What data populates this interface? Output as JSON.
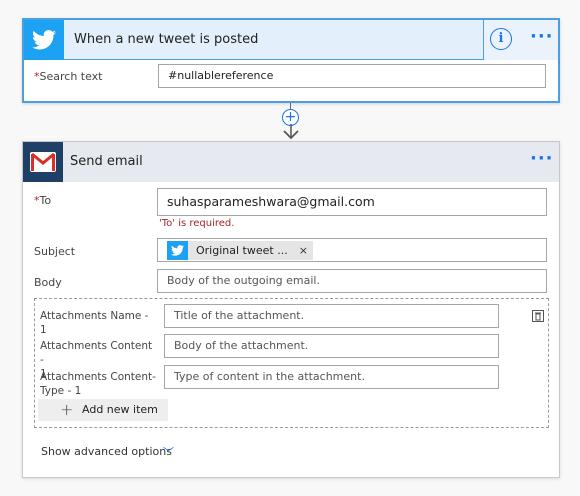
{
  "trigger": {
    "title": "When a new tweet is posted",
    "search_label": "Search text",
    "required_mark": "*",
    "search_value": "#nullablereference"
  },
  "action": {
    "title": "Send email",
    "to_label": "To",
    "required_mark": "*",
    "to_value": "suhasparameshwara@gmail.com",
    "to_error": "'To' is required.",
    "subject_label": "Subject",
    "subject_token": "Original tweet ...",
    "token_remove": "×",
    "body_label": "Body",
    "body_placeholder": "Body of the outgoing email.",
    "attachments": {
      "name_label": "Attachments Name - 1",
      "name_placeholder": "Title of the attachment.",
      "content_label_1": "Attachments Content -",
      "content_label_2": "1",
      "content_placeholder": "Body of the attachment.",
      "type_label_1": "Attachments Content-",
      "type_label_2": "Type - 1",
      "type_placeholder": "Type of content in the attachment.",
      "add_new_item": "Add new item"
    },
    "show_advanced": "Show advanced options"
  },
  "icons": {
    "info": "i",
    "more": "···",
    "connector_plus": "+",
    "chevron": "﹀"
  },
  "colors": {
    "twitter_blue": "#1da1f2",
    "gmail_header": "#1e3f66",
    "accent": "#1a73e8",
    "error": "#a4262c"
  }
}
